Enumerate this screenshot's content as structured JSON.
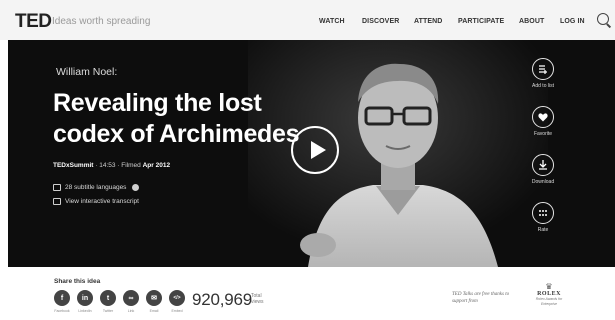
{
  "header": {
    "logo": "TED",
    "tagline": "Ideas worth spreading",
    "nav": [
      "WATCH",
      "DISCOVER",
      "ATTEND",
      "PARTICIPATE",
      "ABOUT",
      "LOG IN"
    ]
  },
  "talk": {
    "speaker": "William Noel:",
    "title": "Revealing the lost codex of Archimedes",
    "event_name": "TEDxSummit",
    "event_meta": " · 14:53 · Filmed ",
    "filmed_date": "Apr 2012",
    "subtitles": "28 subtitle languages",
    "transcript": "View interactive transcript"
  },
  "actions": [
    {
      "label": "Add to list",
      "icon": "add-to-list-icon"
    },
    {
      "label": "Favorite",
      "icon": "heart-icon"
    },
    {
      "label": "Download",
      "icon": "download-icon"
    },
    {
      "label": "Rate",
      "icon": "rate-icon"
    }
  ],
  "share": {
    "title": "Share this idea",
    "buttons": [
      {
        "glyph": "f",
        "label": "Facebook",
        "icon": "facebook-icon"
      },
      {
        "glyph": "in",
        "label": "LinkedIn",
        "icon": "linkedin-icon"
      },
      {
        "glyph": "t",
        "label": "Twitter",
        "icon": "twitter-icon"
      },
      {
        "glyph": "∞",
        "label": "Link",
        "icon": "link-icon"
      },
      {
        "glyph": "✉",
        "label": "Email",
        "icon": "email-icon"
      },
      {
        "glyph": "</>",
        "label": "Embed",
        "icon": "embed-icon"
      }
    ],
    "views": "920,969",
    "views_label": "Total views"
  },
  "sponsor": {
    "note": "TED Talks are free thanks to support from",
    "name": "ROLEX",
    "award": "Rolex Awards for Enterprise"
  },
  "colors": {
    "hero_bg": "#0d0d0d",
    "topbar_bg": "#f4f4f4",
    "icon_dark": "#444444"
  }
}
